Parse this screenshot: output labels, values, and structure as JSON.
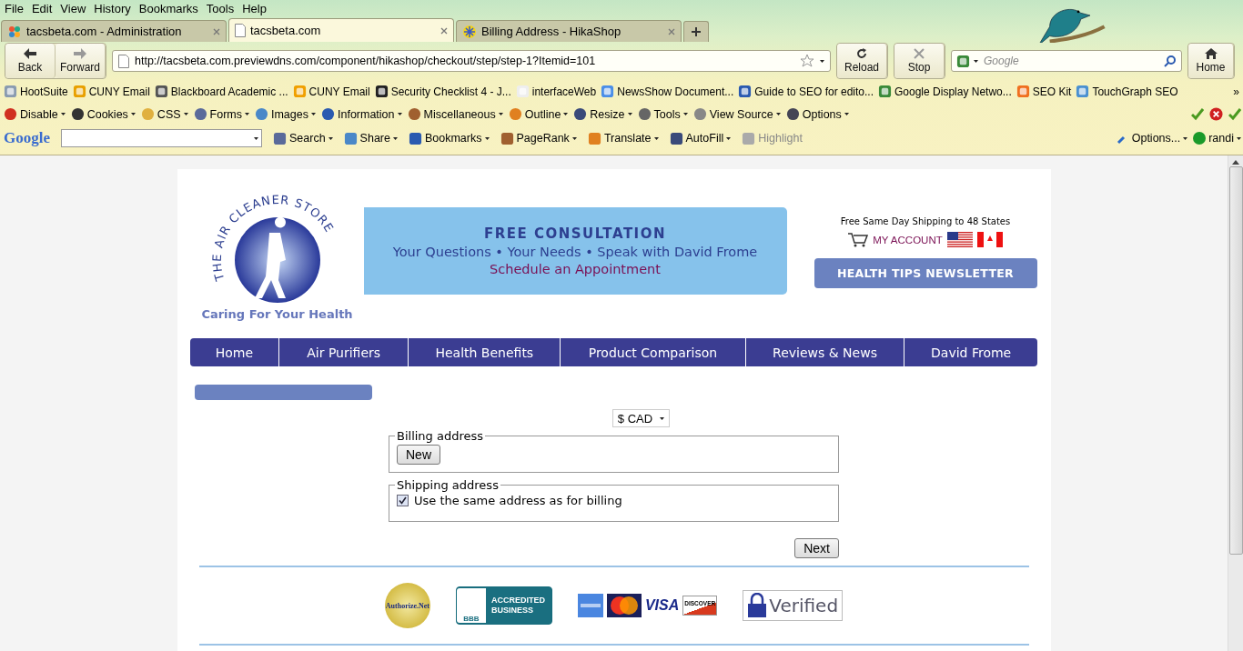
{
  "menu": [
    "File",
    "Edit",
    "View",
    "History",
    "Bookmarks",
    "Tools",
    "Help"
  ],
  "tabs": [
    {
      "title": "tacsbeta.com - Administration",
      "selected": false,
      "kind": "joomla"
    },
    {
      "title": "tacsbeta.com",
      "selected": true,
      "kind": "page"
    },
    {
      "title": "Billing Address - HikaShop",
      "selected": false,
      "kind": "hika"
    }
  ],
  "nav": {
    "back": "Back",
    "forward": "Forward",
    "url": "http://tacsbeta.com.previewdns.com/component/hikashop/checkout/step/step-1?Itemid=101",
    "reload": "Reload",
    "stop": "Stop",
    "search_placeholder": "Google",
    "home": "Home"
  },
  "bookmarks": [
    "HootSuite",
    "CUNY Email",
    "Blackboard Academic ...",
    "CUNY Email",
    "Security Checklist 4 - J...",
    "interfaceWeb",
    "NewsShow Document...",
    "Guide to SEO for edito...",
    "Google Display Netwo...",
    "SEO Kit",
    "TouchGraph SEO"
  ],
  "bookmarks_more": "»",
  "dev_toolbar": [
    "Disable",
    "Cookies",
    "CSS",
    "Forms",
    "Images",
    "Information",
    "Miscellaneous",
    "Outline",
    "Resize",
    "Tools",
    "View Source",
    "Options"
  ],
  "google_toolbar": {
    "logo": "Google",
    "items": [
      {
        "label": "Search",
        "disabled": false
      },
      {
        "label": "Share",
        "disabled": false
      },
      {
        "label": "Bookmarks",
        "disabled": false
      },
      {
        "label": "PageRank",
        "disabled": false
      },
      {
        "label": "Translate",
        "disabled": false
      },
      {
        "label": "AutoFill",
        "disabled": false
      },
      {
        "label": "Highlight",
        "disabled": true
      }
    ],
    "options": "Options...",
    "user": "randi"
  },
  "page": {
    "logo_text": "THE AIR CLEANER STORE",
    "tagline": "Caring For Your Health",
    "banner": {
      "title": "FREE CONSULTATION",
      "line": "Your Questions • Your Needs • Speak with David Frome",
      "link": "Schedule an Appointment"
    },
    "shipping_note": "Free Same Day Shipping to 48 States",
    "account": "MY ACCOUNT",
    "newsletter": "HEALTH TIPS NEWSLETTER",
    "menu": [
      "Home",
      "Air Purifiers",
      "Health Benefits",
      "Product Comparison",
      "Reviews & News",
      "David Frome"
    ],
    "currency": "$ CAD",
    "billing": {
      "legend": "Billing address",
      "button": "New"
    },
    "shipping": {
      "legend": "Shipping address",
      "label": "Use the same address as for billing",
      "checked": true
    },
    "next": "Next",
    "badges": {
      "authorize": "Authorize.Net",
      "bbb": "BBB",
      "accredited": "ACCREDITED BUSINESS",
      "visa": "VISA",
      "discover": "DISCOVER",
      "verified": "Verified"
    }
  }
}
